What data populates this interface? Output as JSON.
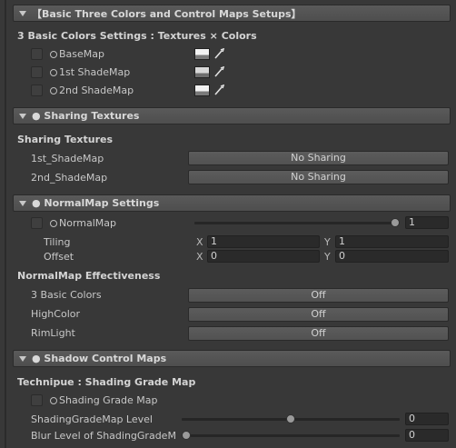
{
  "sections": {
    "basic": {
      "title": "【Basic Three Colors and Control Maps Setups】",
      "heading": "3 Basic Colors Settings : Textures × Colors",
      "rows": [
        {
          "label": "BaseMap"
        },
        {
          "label": "1st ShadeMap"
        },
        {
          "label": "2nd ShadeMap"
        }
      ]
    },
    "sharing": {
      "title": "● Sharing Textures",
      "heading": "Sharing Textures",
      "rows": [
        {
          "label": "1st_ShadeMap",
          "value": "No Sharing"
        },
        {
          "label": "2nd_ShadeMap",
          "value": "No Sharing"
        }
      ]
    },
    "normal": {
      "title": "● NormalMap Settings",
      "normalmap_label": "NormalMap",
      "normalmap_value": "1",
      "normalmap_fraction": 1.0,
      "tiling_label": "Tiling",
      "offset_label": "Offset",
      "x_axis": "X",
      "y_axis": "Y",
      "tiling_x": "1",
      "tiling_y": "1",
      "offset_x": "0",
      "offset_y": "0",
      "effect_heading": "NormalMap Effectiveness",
      "effects": [
        {
          "label": "3 Basic Colors",
          "value": "Off"
        },
        {
          "label": "HighColor",
          "value": "Off"
        },
        {
          "label": "RimLight",
          "value": "Off"
        }
      ]
    },
    "shadow": {
      "title": "● Shadow Control Maps",
      "heading": "Technipue : Shading Grade Map",
      "grade_map_label": "Shading Grade Map",
      "level_label": "ShadingGradeMap Level",
      "level_value": "0",
      "level_fraction": 0.5,
      "blur_label": "Blur Level of ShadingGradeM",
      "blur_value": "0",
      "blur_fraction": 0.0
    }
  }
}
